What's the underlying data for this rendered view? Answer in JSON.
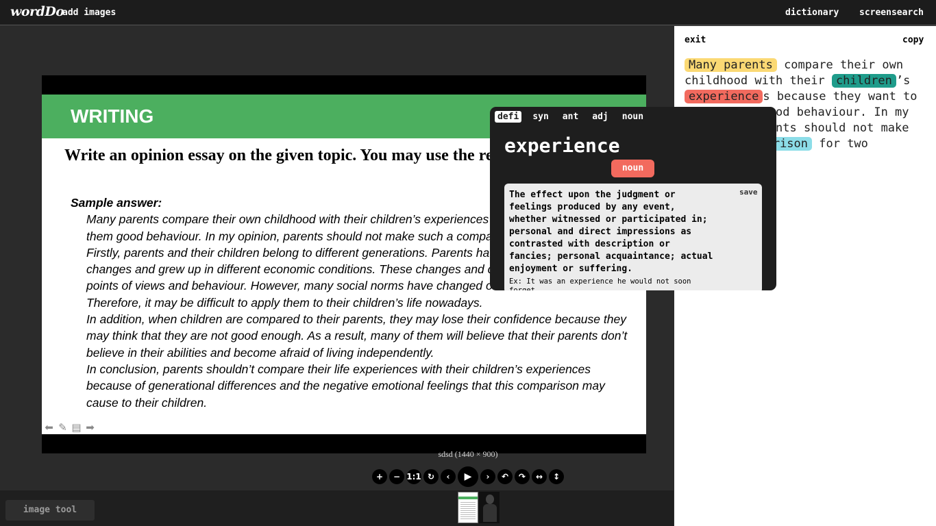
{
  "app": {
    "logo": "wordDo",
    "nav_add_images": "add images",
    "nav_dictionary": "dictionary",
    "nav_screensearch": "screensearch"
  },
  "slide": {
    "title": "WRITING",
    "instruction": "Write an opinion essay on the given topic. You may use the reading to help you.",
    "sample_label": "Sample answer:",
    "paragraphs": [
      "Many parents compare their own childhood with their children’s experiences because they want to teach them good behaviour. In my opinion, parents should not make such a comparison for two reasons.",
      "Firstly, parents and their children belong to different generations. Parents have witnessed many social changes and grew up in different economic conditions. These changes and conditions have formed their points of views and behaviour. However, many social norms have changed over the last decades. Therefore, it may be difficult to apply them to their children’s life nowadays.",
      "In addition, when children are compared to their parents, they may lose their confidence because they may think that they are not good enough. As a result, many of them will believe that their parents don’t believe in their abilities and become afraid of living independently.",
      "In conclusion, parents shouldn’t compare their life experiences with their children’s experiences because of generational differences and the negative emotional feelings that this comparison may cause to their children."
    ],
    "tool_icons": [
      "arrow-left-icon",
      "pencil-icon",
      "notes-icon",
      "arrow-right-icon"
    ]
  },
  "image_caption": "sdsd (1440 × 900)",
  "viewer_toolbar": {
    "buttons": [
      {
        "name": "zoom-in-button",
        "glyph": "+"
      },
      {
        "name": "zoom-out-button",
        "glyph": "−"
      },
      {
        "name": "one-to-one-button",
        "glyph": "1:1"
      },
      {
        "name": "reset-button",
        "glyph": "↻"
      },
      {
        "name": "prev-button",
        "glyph": "‹"
      },
      {
        "name": "play-button",
        "glyph": "▶"
      },
      {
        "name": "next-button",
        "glyph": "›"
      },
      {
        "name": "rotate-left-button",
        "glyph": "↶"
      },
      {
        "name": "rotate-right-button",
        "glyph": "↷"
      },
      {
        "name": "flip-horizontal-button",
        "glyph": "↔"
      },
      {
        "name": "flip-vertical-button",
        "glyph": "↕"
      }
    ]
  },
  "bottom": {
    "image_tool_label": "image tool"
  },
  "side_panel": {
    "exit_label": "exit",
    "copy_label": "copy",
    "text_segments": [
      {
        "text": "Many parents",
        "highlight": "yellow"
      },
      {
        "text": " compare their own childhood with their ",
        "highlight": null
      },
      {
        "text": "children",
        "highlight": "teal"
      },
      {
        "text": "’s ",
        "highlight": null
      },
      {
        "text": "experience",
        "highlight": "red"
      },
      {
        "text": "s because they want to teach them good behaviour. In my opinion, parents should not make such a ",
        "highlight": null
      },
      {
        "text": "comparison",
        "highlight": "cyan"
      },
      {
        "text": " for two",
        "highlight": null
      }
    ],
    "highlight_colors": {
      "yellow": "#fbd974",
      "teal": "#1f9c8b",
      "red": "#f26a5e",
      "cyan": "#8cdde8"
    }
  },
  "popup": {
    "tabs": [
      "defi",
      "syn",
      "ant",
      "adj",
      "noun"
    ],
    "active_tab": "defi",
    "word": "experience",
    "part_of_speech": "noun",
    "definition": "The effect upon the judgment or feelings produced by any event, whether witnessed or participated in; personal and direct impressions as contrasted with description or fancies; personal acquaintance; actual enjoyment or suffering.",
    "example": "Ex: It was an experience he would not soon forget.",
    "save_label": "save"
  },
  "colors": {
    "slide_header_green": "#4caf5f",
    "pos_badge_red": "#f26a5e",
    "topbar": "#1c1c1c",
    "popup_bg": "#1e1e1e"
  }
}
